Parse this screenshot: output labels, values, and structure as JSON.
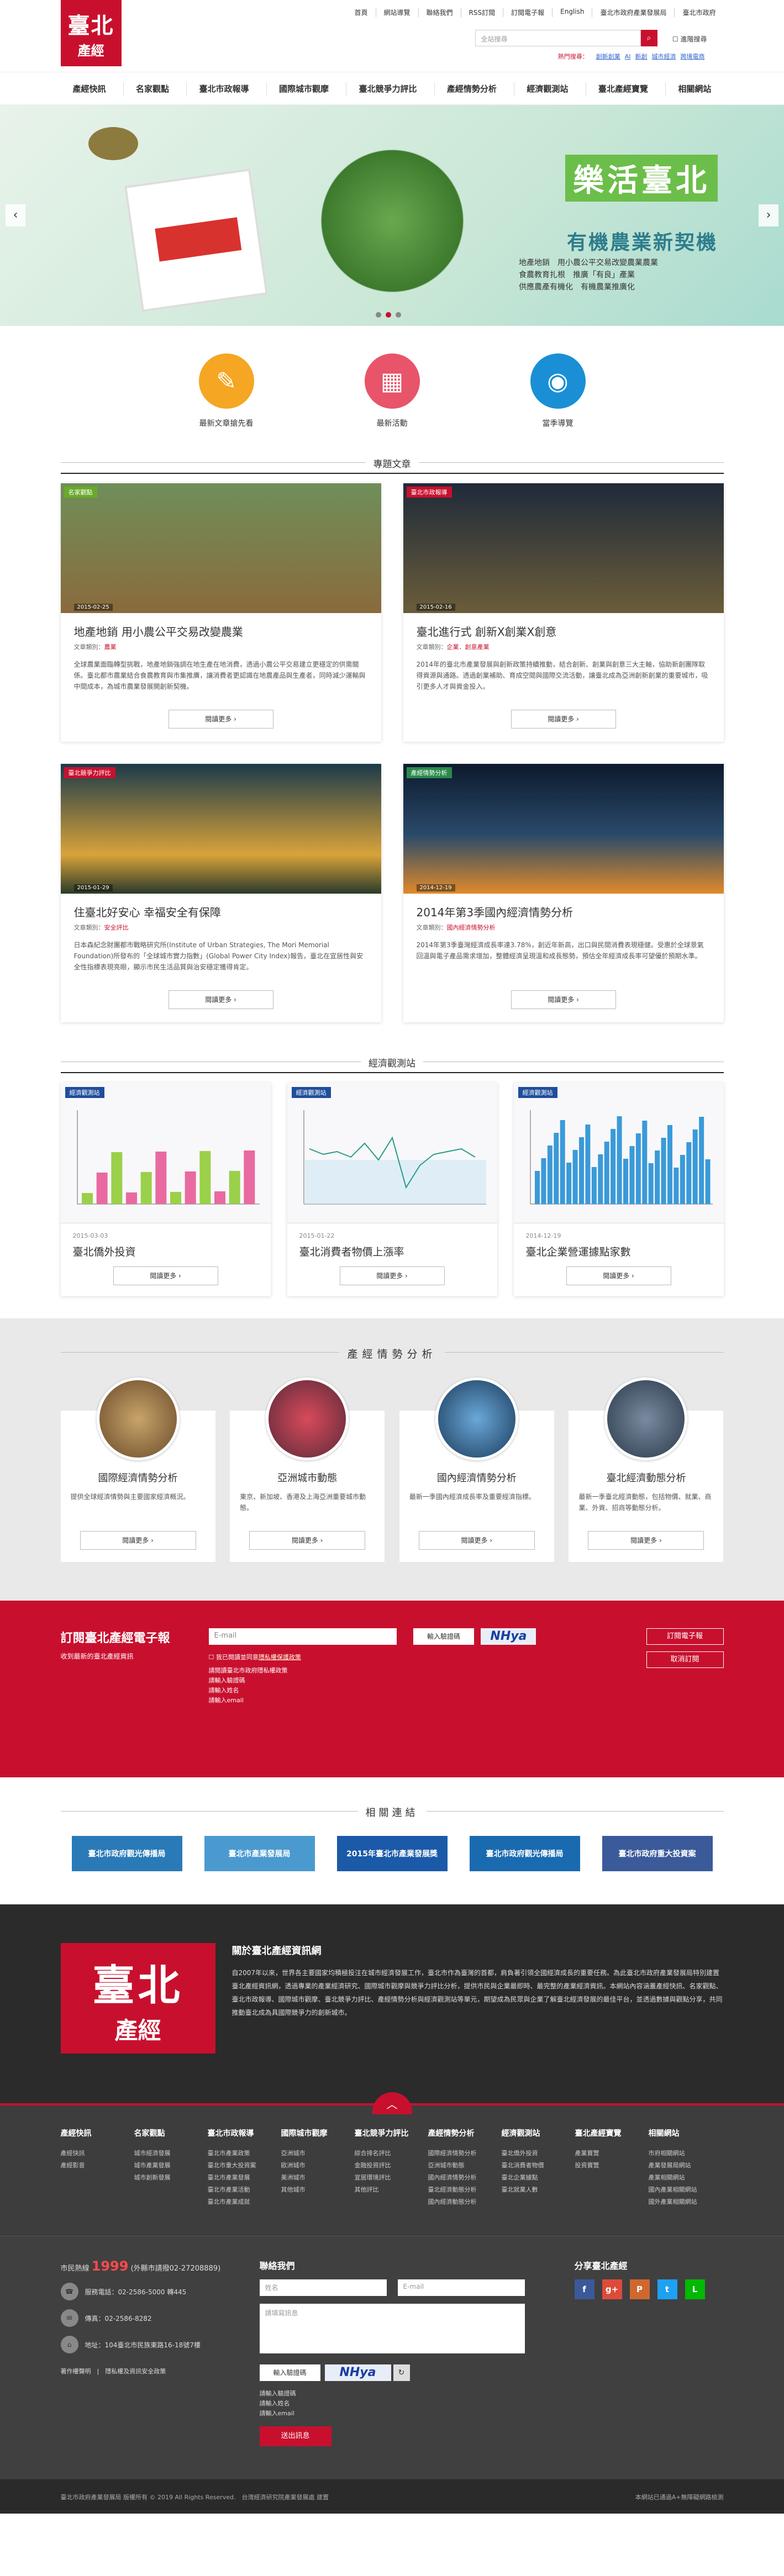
{
  "header": {
    "logo_big": "臺北",
    "logo_small": "產經",
    "top_links": [
      "首頁",
      "網站導覽",
      "聯絡我們",
      "RSS訂閱",
      "訂閱電子報",
      "English",
      "臺北市政府產業發展局",
      "臺北市政府"
    ],
    "search_placeholder": "全站搜尋",
    "search_icon": "search-icon",
    "advanced_search": "進階搜尋",
    "hot_label": "熱門搜尋：",
    "hot_words": [
      "創新創業",
      "AI",
      "新創",
      "城市經濟",
      "跨境電商"
    ]
  },
  "nav": [
    "產經快訊",
    "名家觀點",
    "臺北市政報導",
    "國際城市觀摩",
    "臺北競爭力評比",
    "產經情勢分析",
    "經濟觀測站",
    "臺北產經寶覽",
    "相關網站"
  ],
  "banner": {
    "title": "樂活臺北",
    "subtitle": "有機農業新契機",
    "desc": [
      "地產地銷　用小農公平交易改變農業農業",
      "食農教育扎根　推廣「有良」產業",
      "供應農產有機化　有機農業推廣化"
    ],
    "prev_icon": "chevron-left-icon",
    "next_icon": "chevron-right-icon"
  },
  "quick": [
    {
      "label": "最新文章搶先看",
      "icon": "search-doc-icon",
      "color": "#f5a623",
      "glyph": "✎"
    },
    {
      "label": "最新活動",
      "icon": "calendar-icon",
      "color": "#e8546a",
      "glyph": "▦"
    },
    {
      "label": "當季導覽",
      "icon": "compass-icon",
      "color": "#1a8fd6",
      "glyph": "◉"
    }
  ],
  "feature_heading": "專題文章",
  "articles": [
    {
      "tag": "名家觀點",
      "tag_color": "#6aaa2a",
      "date": "2015-02-25",
      "title": "地產地銷 用小農公平交易改變農業",
      "meta_label": "文章類別：",
      "meta_cat": "農業",
      "text": "全球農業面臨轉型挑戰，地產地銷強調在地生產在地消費，透過小農公平交易建立更穩定的供需關係。臺北都市農業結合食農教育與市集推廣，讓消費者更認識在地農產品與生產者，同時減少運輸與中間成本，為城市農業發展開創新契機。",
      "more": "閱讀更多 ›",
      "bg": "linear-gradient(180deg,#6f8f5a,#8a6a3c)"
    },
    {
      "tag": "臺北市政報導",
      "tag_color": "#c8102e",
      "date": "2015-02-16",
      "title": "臺北進行式 創新X創業X創意",
      "meta_label": "文章類別：",
      "meta_cat": "企業．創意產業",
      "text": "2014年的臺北市產業發展與創新政策持續推動，結合創新、創業與創意三大主軸，協助新創團隊取得資源與通路。透過創業補助、育成空間與國際交流活動，讓臺北成為亞洲創新創業的重要城市，吸引更多人才與資金投入。",
      "more": "閱讀更多 ›",
      "bg": "linear-gradient(180deg,#1f2a3a,#6b5d3a)"
    },
    {
      "tag": "臺北競爭力評比",
      "tag_color": "#c8102e",
      "date": "2015-01-29",
      "title": "住臺北好安心 幸福安全有保障",
      "meta_label": "文章類別：",
      "meta_cat": "安全評比",
      "text": "日本森紀念財團都市戰略研究所(Institute of Urban Strategies, The Mori Memorial Foundation)所發布的「全球城市實力指數」(Global Power City Index)報告，臺北在宜居性與安全性指標表現亮眼，顯示市民生活品質與治安穩定獲得肯定。",
      "more": "閱讀更多 ›",
      "bg": "linear-gradient(180deg,#1b3a4a,#d9a33a 70%,#2a3a2a)"
    },
    {
      "tag": "產經情勢分析",
      "tag_color": "#2a8a4a",
      "date": "2014-12-19",
      "title": "2014年第3季國內經濟情勢分析",
      "meta_label": "文章類別：",
      "meta_cat": "國內經濟情勢分析",
      "text": "2014年第3季臺灣經濟成長率達3.78%，創近年新高，出口與民間消費表現穩健。受惠於全球景氣回溫與電子產品需求增加，整體經濟呈現溫和成長態勢，預估全年經濟成長率可望優於預期水準。",
      "more": "閱讀更多 ›",
      "bg": "linear-gradient(180deg,#0d1a2e,#2a4a6a 55%,#e08a2a)"
    }
  ],
  "econ_heading": "經濟觀測站",
  "econ": [
    {
      "tag": "經濟觀測站",
      "date": "2015-03-03",
      "title": "臺北僑外投資",
      "more": "閱讀更多 ›",
      "chart_kind": "bar"
    },
    {
      "tag": "經濟觀測站",
      "date": "2015-01-22",
      "title": "臺北消費者物價上漲率",
      "more": "閱讀更多 ›",
      "chart_kind": "line"
    },
    {
      "tag": "經濟觀測站",
      "date": "2014-12-19",
      "title": "臺北企業營運據點家數",
      "more": "閱讀更多 ›",
      "chart_kind": "bar2"
    }
  ],
  "status_heading": "產經情勢分析",
  "status": [
    {
      "title": "國際經濟情勢分析",
      "text": "提供全球經濟情勢與主要國家經濟概況。",
      "more": "閱讀更多 ›",
      "bg": "radial-gradient(circle,#c9a46a,#6a4a2a)"
    },
    {
      "title": "亞洲城市動態",
      "text": "東京、新加坡、香港及上海亞洲重要城市動態。",
      "more": "閱讀更多 ›",
      "bg": "radial-gradient(circle,#d84a5a,#5a2a3a)"
    },
    {
      "title": "國內經濟情勢分析",
      "text": "最新一季國內經濟成長率及重要經濟指標。",
      "more": "閱讀更多 ›",
      "bg": "radial-gradient(circle,#6aa8d8,#1a3a5a)"
    },
    {
      "title": "臺北經濟動態分析",
      "text": "最新一季臺北經濟動態，包括物價、就業、商業、外資、招商等動態分析。",
      "more": "閱讀更多 ›",
      "bg": "radial-gradient(circle,#7a8aa0,#2a3a4a)"
    }
  ],
  "subscribe": {
    "title": "訂閱臺北產經電子報",
    "subtitle": "收到最新的臺北產經資訊",
    "email_placeholder": "E-mail",
    "captcha_placeholder": "輸入驗證碼",
    "captcha_img": "NHya",
    "agree": "我已閱讀並同意",
    "agree_link": "隱私權保護政策",
    "list": [
      "請閱讀臺北市政府隱私權政策",
      "請輸入驗證碼",
      "請輸入姓名",
      "請輸入email"
    ],
    "btn_subscribe": "訂閱電子報",
    "btn_cancel": "取消訂閱"
  },
  "links_heading": "相關連結",
  "links": [
    {
      "label": "臺北市政府觀光傳播局",
      "bg": "#2a7ab8"
    },
    {
      "label": "臺北市產業發展局",
      "bg": "#4a9ad0"
    },
    {
      "label": "2015年臺北市產業發展獎",
      "bg": "#1a5aa8"
    },
    {
      "label": "臺北市政府觀光傳播局",
      "bg": "#1a6ab0"
    },
    {
      "label": "臺北市政府重大投資案",
      "bg": "#3a5a9a"
    }
  ],
  "about": {
    "title": "關於臺北產經資訊網",
    "text": "自2007年以來，世界各主要國家均積極投注在城市經濟發展工作，臺北市作為臺灣的首都，肩負著引領全國經濟成長的重要任務。為此臺北市政府產業發展局特別建置臺北產經資訊網，透過專業的產業經濟研究、國際城市觀摩與競爭力評比分析，提供市民與企業最即時、最完整的產業經濟資訊。本網站內容涵蓋產經快訊、名家觀點、臺北市政報導、國際城市觀摩、臺北競爭力評比、產經情勢分析與經濟觀測站等單元，期望成為民眾與企業了解臺北經濟發展的最佳平台，並透過數據與觀點分享，共同推動臺北成為具國際競爭力的創新城市。",
    "up_icon": "arrow-up-icon"
  },
  "footer_nav": [
    {
      "h": "產經快訊",
      "items": [
        "產經快訊",
        "產經影音"
      ]
    },
    {
      "h": "名家觀點",
      "items": [
        "城市經濟發展",
        "城市產業發展",
        "城市創新發展"
      ]
    },
    {
      "h": "臺北市政報導",
      "items": [
        "臺北市產業政策",
        "臺北市重大投資案",
        "臺北市產業發展",
        "臺北市產業活動",
        "臺北市產業成就"
      ]
    },
    {
      "h": "國際城市觀摩",
      "items": [
        "亞洲城市",
        "歐洲城市",
        "美洲城市",
        "其他城市"
      ]
    },
    {
      "h": "臺北競爭力評比",
      "items": [
        "綜合排名評比",
        "金融投資評比",
        "宜居環境評比",
        "其他評比"
      ]
    },
    {
      "h": "產經情勢分析",
      "items": [
        "國際經濟情勢分析",
        "亞洲城市動態",
        "國內經濟情勢分析",
        "臺北經濟動態分析",
        "國內經濟動態分析"
      ]
    },
    {
      "h": "經濟觀測站",
      "items": [
        "臺北僑外投資",
        "臺北消費者物價",
        "臺北企業據點",
        "臺北就業人數"
      ]
    },
    {
      "h": "臺北產經寶覽",
      "items": [
        "產業寶覽",
        "投資寶覽"
      ]
    },
    {
      "h": "相關網站",
      "items": [
        "市府相關網站",
        "產業發展局網站",
        "產業相關網站",
        "國內產業相關網站",
        "國外產業相關網站"
      ]
    }
  ],
  "contact": {
    "hotline_pre": "市民熱線",
    "hotline": "1999",
    "hotline_post": "(外縣市請撥02-27208889)",
    "phone": "服務電話：02-2586-5000 轉445",
    "fax": "傳真：02-2586-8282",
    "addr": "地址：104臺北市民族東路16-18號7樓",
    "bottom": "著作權聲明　|　隱私權及資訊安全政策",
    "form_title": "聯絡我們",
    "name_ph": "姓名",
    "email_ph": "E-mail",
    "msg_ph": "請填寫訊息",
    "captcha_ph": "輸入驗證碼",
    "captcha_img": "NHya",
    "list": [
      "請輸入驗證碼",
      "請輸入姓名",
      "請輸入email"
    ],
    "send": "送出訊息",
    "social_title": "分享臺北產經",
    "social": [
      {
        "name": "facebook-icon",
        "glyph": "f",
        "color": "#3b5998"
      },
      {
        "name": "google-plus-icon",
        "glyph": "g+",
        "color": "#dd4b39"
      },
      {
        "name": "plurk-icon",
        "glyph": "P",
        "color": "#cf682f"
      },
      {
        "name": "twitter-icon",
        "glyph": "t",
        "color": "#1da1f2"
      },
      {
        "name": "line-icon",
        "glyph": "L",
        "color": "#00b900"
      }
    ]
  },
  "copyright": "臺北市政府產業發展局 版權所有 © 2019 All Rights Reserved.　台灣經濟研究院產業發展處 建置",
  "copyright_right": "本網站已通過A+無障礙網路檢測"
}
